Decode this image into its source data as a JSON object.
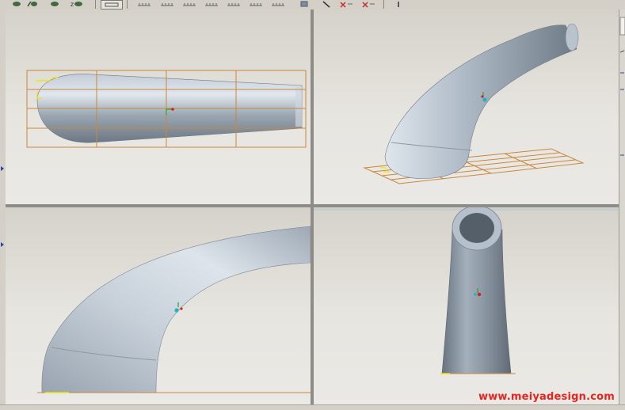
{
  "toolbar": {
    "buttons": [
      {
        "name": "view-icon-1",
        "glyph": ""
      },
      {
        "name": "view-icon-2",
        "glyph": ""
      },
      {
        "name": "view-icon-3",
        "glyph": ""
      },
      {
        "name": "zoom-z-icon",
        "glyph": "z"
      },
      {
        "name": "view-icon-4",
        "glyph": ""
      }
    ]
  },
  "viewports": {
    "top_left": {
      "view": "top"
    },
    "top_right": {
      "view": "isometric"
    },
    "bottom_left": {
      "view": "side"
    },
    "bottom_right": {
      "view": "front"
    }
  },
  "colors": {
    "model_body": "#a7b3bf",
    "model_highlight": "#dde4ec",
    "model_shadow": "#6f7a85",
    "grid_plane": "#c9883c",
    "watermark": "#e8241e"
  },
  "watermark": "www.meiyadesign.com"
}
